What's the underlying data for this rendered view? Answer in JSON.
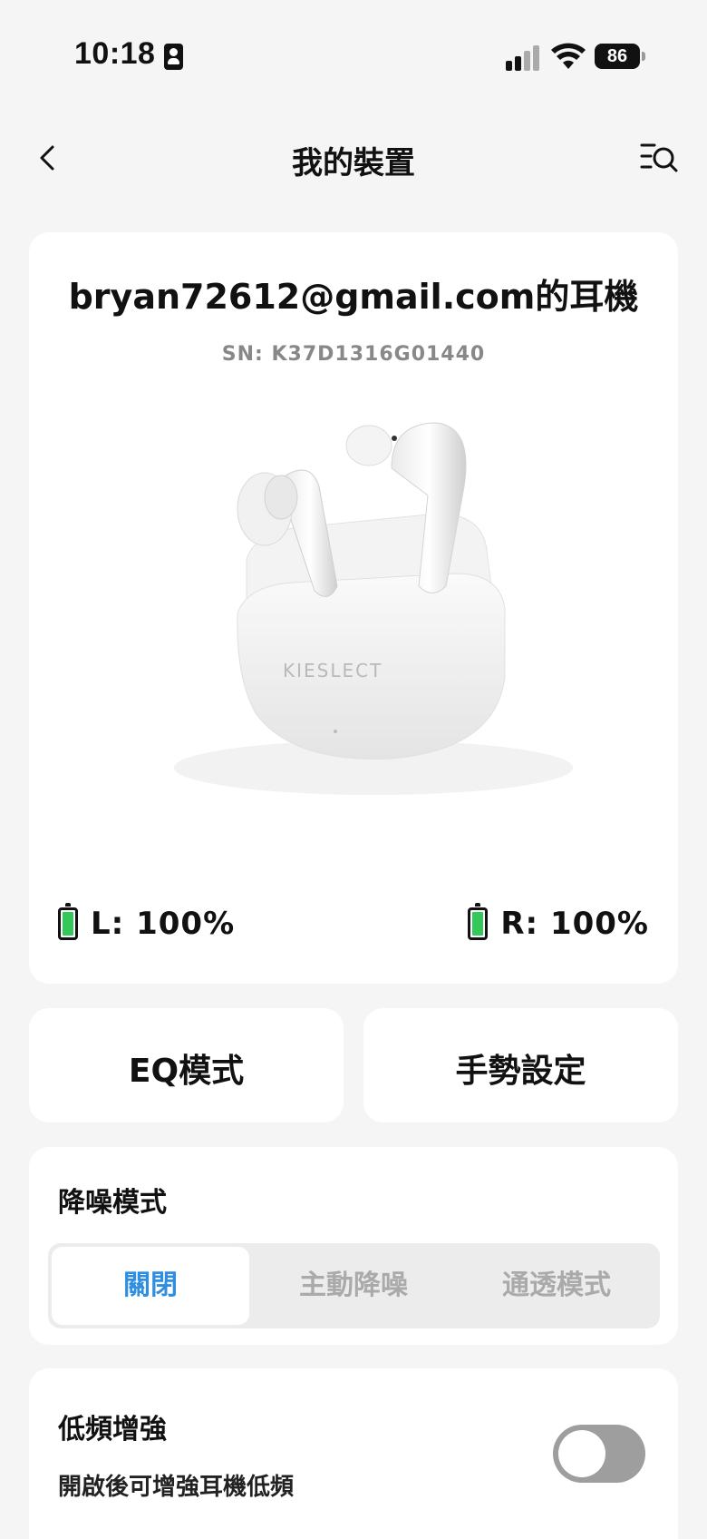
{
  "status_bar": {
    "time": "10:18",
    "battery_level": "86",
    "icons": [
      "id-card-icon",
      "cellular-signal-icon",
      "wifi-icon",
      "battery-icon"
    ]
  },
  "nav": {
    "title": "我的裝置",
    "back_icon": "chevron-left-icon",
    "menu_icon": "list-search-icon"
  },
  "device": {
    "name": "bryan72612@gmail.com的耳機",
    "sn": "SN: K37D1316G01440",
    "image_brand": "KIESLECT",
    "left_battery": "L: 100%",
    "right_battery": "R: 100%",
    "battery_color": "#34c759"
  },
  "actions": {
    "eq_label": "EQ模式",
    "gesture_label": "手勢設定"
  },
  "anc": {
    "title": "降噪模式",
    "options": [
      "關閉",
      "主動降噪",
      "通透模式"
    ],
    "selected": "關閉",
    "accent": "#2f8ee0"
  },
  "bass": {
    "title": "低頻增強",
    "description": "開啟後可增強耳機低頻",
    "enabled": false
  }
}
